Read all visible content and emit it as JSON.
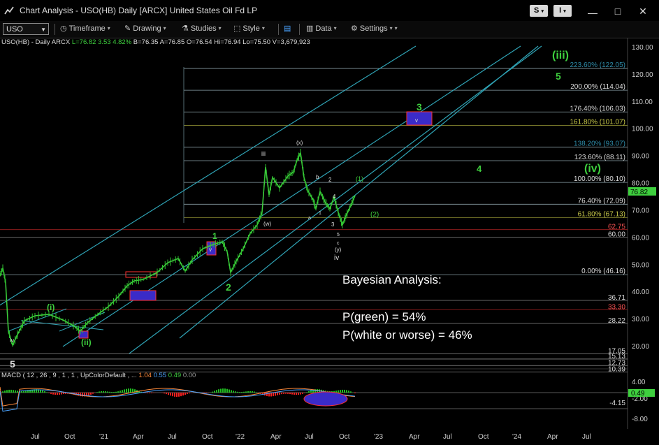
{
  "window": {
    "title": "Chart Analysis - USO(HB) Daily [ARCX] United States Oil Fd LP",
    "s_button": "S",
    "i_button": "I"
  },
  "toolbar": {
    "symbol": "USO",
    "timeframe": "Timeframe",
    "drawing": "Drawing",
    "studies": "Studies",
    "style": "Style",
    "data": "Data",
    "settings": "Settings"
  },
  "legend": {
    "prefix": "USO(HB) - Daily  ARCX",
    "last": "L=76.82",
    "chg": "3.53",
    "pct": "4.82%",
    "rest": "B=76.35  A=76.85  O=76.54  Hi=76.94  Lo=75.50  V=3,679,923"
  },
  "macd_legend": {
    "label": "MACD ( 12 , 26 , 9 , 1 , 1 , UpColorDefault , ...",
    "v1": "1.04",
    "v2": "0.55",
    "v3": "0.49",
    "v4": "0.00"
  },
  "bayes": {
    "title": "Bayesian Analysis:",
    "green": "P(green) =  54%",
    "white": "P(white or worse) = 46%"
  },
  "price_axis": [
    "130.00",
    "120.00",
    "110.00",
    "100.00",
    "90.00",
    "80.00",
    "70.00",
    "60.00",
    "50.00",
    "40.00",
    "30.00",
    "20.00"
  ],
  "macd_axis": [
    "4.00",
    "-2.00",
    "-8.00"
  ],
  "last_price": "76.82",
  "macd_last": "0.49",
  "macd_level": "-4.15",
  "fib_levels": [
    {
      "label": "223.60% (122.05)",
      "price": 122.05,
      "color": "#2e8ba8"
    },
    {
      "label": "200.00% (114.04)",
      "price": 114.04,
      "color": "#dddddd"
    },
    {
      "label": "176.40% (106.03)",
      "price": 106.03,
      "color": "#dddddd"
    },
    {
      "label": "161.80% (101.07)",
      "price": 101.07,
      "color": "#c9c94a"
    },
    {
      "label": "138.20% (93.07)",
      "price": 93.07,
      "color": "#2e8ba8"
    },
    {
      "label": "123.60% (88.11)",
      "price": 88.11,
      "color": "#dddddd"
    },
    {
      "label": "100.00% (80.10)",
      "price": 80.1,
      "color": "#dddddd"
    },
    {
      "label": "76.40% (72.09)",
      "price": 72.09,
      "color": "#dddddd"
    },
    {
      "label": "61.80% (67.13)",
      "price": 67.13,
      "color": "#c9c94a"
    },
    {
      "label": "0.00% (46.16)",
      "price": 46.16,
      "color": "#dddddd"
    }
  ],
  "h_levels": [
    {
      "label": "62.75",
      "price": 62.75,
      "color": "#ff5555",
      "line": "#a02020"
    },
    {
      "label": "60.00",
      "price": 60.0,
      "color": "#dddddd",
      "line": "#888888"
    },
    {
      "label": "36.71",
      "price": 36.71,
      "color": "#dddddd",
      "line": "#888888"
    },
    {
      "label": "33.30",
      "price": 33.3,
      "color": "#ff5555",
      "line": "#a02020"
    },
    {
      "label": "28.22",
      "price": 28.22,
      "color": "#dddddd",
      "line": "#888888"
    },
    {
      "label": "17.05",
      "price": 17.05,
      "color": "#dddddd",
      "line": "#888888"
    },
    {
      "label": "15.13",
      "price": 15.13,
      "color": "#dddddd",
      "line": "#888888"
    },
    {
      "label": "12.73",
      "price": 12.73,
      "color": "#dddddd",
      "line": "#888888"
    },
    {
      "label": "10.39",
      "price": 10.39,
      "color": "#dddddd",
      "line": "#888888"
    }
  ],
  "wave_labels": [
    {
      "t": "(iii)",
      "c": "#3ecf3e"
    },
    {
      "t": "5",
      "c": "#3ecf3e"
    },
    {
      "t": "3",
      "c": "#3ecf3e"
    },
    {
      "t": "4",
      "c": "#3ecf3e"
    },
    {
      "t": "(iv)",
      "c": "#3ecf3e"
    },
    {
      "t": "1",
      "c": "#3ecf3e"
    },
    {
      "t": "2",
      "c": "#3ecf3e"
    },
    {
      "t": "(i)",
      "c": "#3ecf3e"
    },
    {
      "t": "(ii)",
      "c": "#3ecf3e"
    },
    {
      "t": "(2)",
      "c": "#3ecf3e"
    },
    {
      "t": "(1)",
      "c": "#3ecf3e"
    },
    {
      "t": "iii",
      "c": "#dddddd"
    },
    {
      "t": "(x)",
      "c": "#dddddd"
    },
    {
      "t": "b",
      "c": "#dddddd"
    },
    {
      "t": "2",
      "c": "#dddddd"
    },
    {
      "t": "4",
      "c": "#dddddd"
    },
    {
      "t": "a",
      "c": "#dddddd"
    },
    {
      "t": "1",
      "c": "#dddddd"
    },
    {
      "t": "3",
      "c": "#dddddd"
    },
    {
      "t": "5",
      "c": "#dddddd"
    },
    {
      "t": "c",
      "c": "#dddddd"
    },
    {
      "t": "(y)",
      "c": "#dddddd"
    },
    {
      "t": "iv",
      "c": "#dddddd"
    },
    {
      "t": "(w)",
      "c": "#dddddd"
    },
    {
      "t": "v",
      "c": "#dddddd"
    },
    {
      "t": "iv",
      "c": "#dddddd"
    },
    {
      "t": "5",
      "c": "#dddddd"
    },
    {
      "t": "v",
      "c": "#dddddd"
    }
  ],
  "x_axis": [
    "Jul",
    "Oct",
    "'21",
    "Apr",
    "Jul",
    "Oct",
    "'22",
    "Apr",
    "Jul",
    "Oct",
    "'23",
    "Apr",
    "Jul",
    "Oct",
    "'24",
    "Apr",
    "Jul"
  ],
  "colors": {
    "accent": "#3ecf3e",
    "channel": "#2fa3b5",
    "fib": "#c9c94a",
    "box": "#3a2bc8",
    "macd_neg": "#ff2020",
    "macd_pos": "#20c020"
  }
}
